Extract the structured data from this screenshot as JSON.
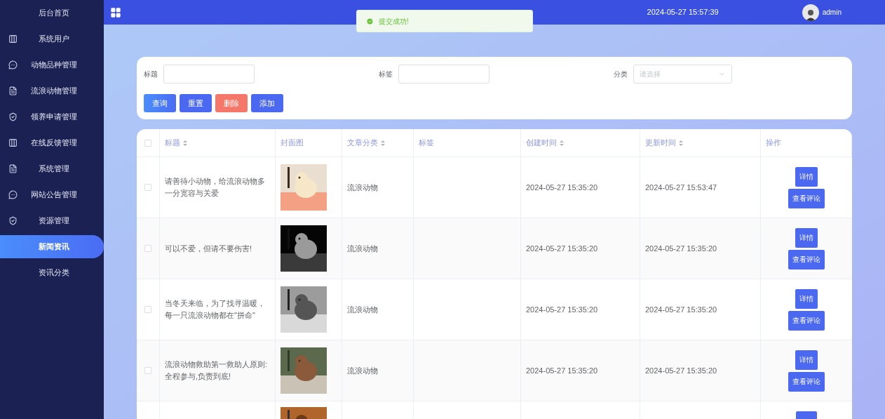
{
  "sidebar": {
    "items": [
      {
        "label": "后台首页",
        "selected": false
      },
      {
        "label": "系统用户",
        "selected": false
      },
      {
        "label": "动物品种管理",
        "selected": false
      },
      {
        "label": "流浪动物管理",
        "selected": false
      },
      {
        "label": "领养申请管理",
        "selected": false
      },
      {
        "label": "在线反馈管理",
        "selected": false
      },
      {
        "label": "系统管理",
        "selected": false
      },
      {
        "label": "网站公告管理",
        "selected": false
      },
      {
        "label": "资源管理",
        "selected": false
      },
      {
        "label": "新闻资讯",
        "selected": true
      },
      {
        "label": "资讯分类",
        "selected": false
      }
    ]
  },
  "topbar": {
    "datetime": "2024-05-27 15:57:39",
    "user": "admin"
  },
  "toast": {
    "message": "提交成功!"
  },
  "search": {
    "fields": [
      {
        "label": "标题",
        "kind": "input"
      },
      {
        "label": "标签",
        "kind": "input"
      },
      {
        "label": "分类",
        "kind": "select",
        "placeholder": "请选择"
      }
    ],
    "buttons": [
      {
        "label": "查询",
        "kind": "primary"
      },
      {
        "label": "重置",
        "kind": "default"
      },
      {
        "label": "删除",
        "kind": "danger"
      },
      {
        "label": "添加",
        "kind": "default"
      }
    ]
  },
  "table": {
    "select_all": {
      "checked": false
    },
    "columns": [
      {
        "label": "标题",
        "sortable": true
      },
      {
        "label": "封面图",
        "sortable": false
      },
      {
        "label": "文章分类",
        "sortable": true
      },
      {
        "label": "标签",
        "sortable": false
      },
      {
        "label": "创建时间",
        "sortable": true
      },
      {
        "label": "更新时间",
        "sortable": true
      },
      {
        "label": "操作",
        "sortable": false
      }
    ],
    "rows": [
      {
        "kind": "full",
        "checked": false,
        "title": "请善待小动物，给流浪动物多一分宽容与关爱",
        "category": "流浪动物",
        "created": "2024-05-27 15:35:20",
        "updated": "2024-05-27 15:53:47",
        "actions": [
          "详情",
          "查看评论"
        ]
      },
      {
        "kind": "full",
        "checked": false,
        "title": "可以不爱，但请不要伤害!",
        "category": "流浪动物",
        "created": "2024-05-27 15:35:20",
        "updated": "2024-05-27 15:35:20",
        "actions": [
          "详情",
          "查看评论"
        ]
      },
      {
        "kind": "full",
        "checked": false,
        "title": "当冬天来临，为了找寻温暖，每一只流浪动物都在\"拼命\"",
        "category": "流浪动物",
        "created": "2024-05-27 15:35:20",
        "updated": "2024-05-27 15:35:20",
        "actions": [
          "详情",
          "查看评论"
        ]
      },
      {
        "kind": "full",
        "checked": false,
        "title": "流浪动物救助第一救助人原则:全程参与,负责到底!",
        "category": "流浪动物",
        "created": "2024-05-27 15:35:20",
        "updated": "2024-05-27 15:35:20",
        "actions": [
          "详情",
          "查看评论"
        ]
      },
      {
        "kind": "partial"
      }
    ]
  }
}
